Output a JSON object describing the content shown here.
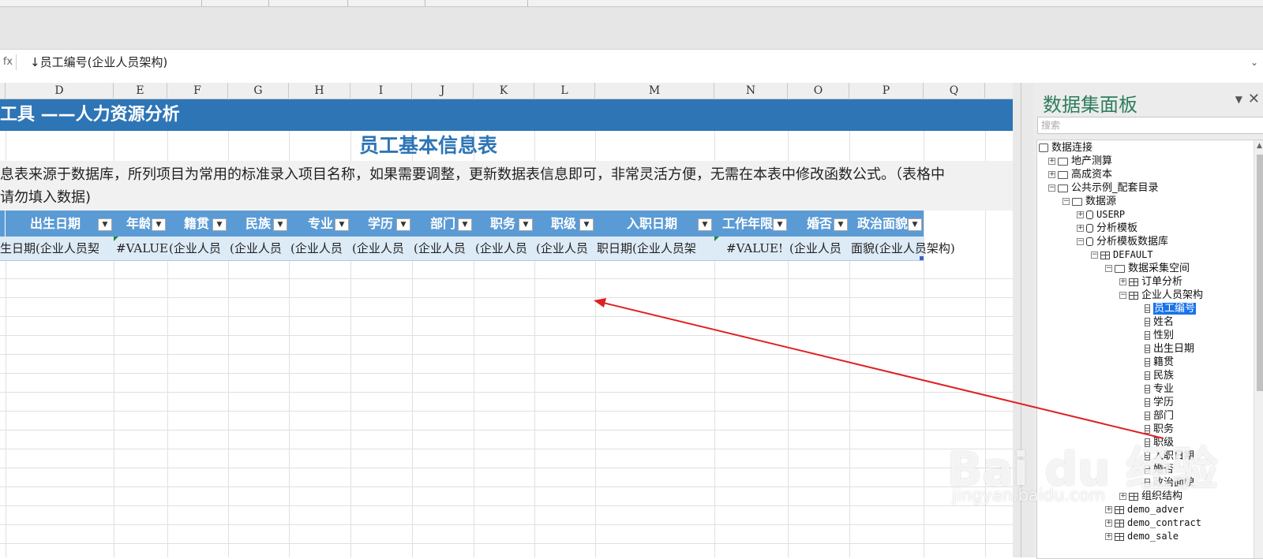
{
  "formula_bar": {
    "fx": "fx",
    "text": "↓员工编号(企业人员架构)",
    "dropdown_icon": "chevron-down-icon"
  },
  "columns": [
    "D",
    "E",
    "F",
    "G",
    "H",
    "I",
    "J",
    "K",
    "L",
    "M",
    "N",
    "O",
    "P",
    "Q"
  ],
  "sheet": {
    "band_title": "工具 ——人力资源分析",
    "title": "员工基本信息表",
    "note_line1": "息表来源于数据库，所列项目为常用的标准录入项目名称，如果需要调整，更新数据表信息即可，非常灵活方便，无需在本表中修改函数公式。（表格中",
    "note_line2": "请勿填入数据)",
    "headers": [
      "出生日期",
      "年龄",
      "籍贯",
      "民族",
      "专业",
      "学历",
      "部门",
      "职务",
      "职级",
      "入职日期",
      "工作年限",
      "婚否",
      "政治面貌"
    ],
    "filter_glyph": "▼",
    "data_row": [
      "生日期(企业人员契",
      "#VALUE!",
      "(企业人员",
      "(企业人员",
      "(企业人员",
      "(企业人员",
      "(企业人员",
      "(企业人员",
      "(企业人员",
      "职日期(企业人员架",
      "#VALUE!",
      "(企业人员",
      "面貌(企业人员架构)"
    ],
    "band_color": "#2e75b6",
    "header_color": "#5b9bd5",
    "data_row_color": "#ddebf7"
  },
  "panel": {
    "title": "数据集面板",
    "pin_glyph": "▼",
    "close_glyph": "✕",
    "search_placeholder": "搜索",
    "tree": [
      {
        "label": "数据连接",
        "icon": "connection-icon"
      },
      {
        "label": "地产测算",
        "icon": "folder-icon"
      },
      {
        "label": "高成资本",
        "icon": "folder-icon"
      },
      {
        "label": "公共示例_配套目录",
        "icon": "folder-icon"
      },
      {
        "label": "数据源",
        "icon": "folder-icon"
      },
      {
        "label": "USERP",
        "icon": "database-icon"
      },
      {
        "label": "分析模板",
        "icon": "database-icon"
      },
      {
        "label": "分析模板数据库",
        "icon": "database-icon"
      },
      {
        "label": "DEFAULT",
        "icon": "schema-icon"
      },
      {
        "label": "数据采集空间",
        "icon": "folder-icon"
      },
      {
        "label": "订单分析",
        "icon": "table-icon"
      },
      {
        "label": "企业人员架构",
        "icon": "table-icon"
      },
      {
        "label": "员工编号",
        "icon": "field-icon"
      },
      {
        "label": "姓名",
        "icon": "field-icon"
      },
      {
        "label": "性别",
        "icon": "field-icon"
      },
      {
        "label": "出生日期",
        "icon": "field-icon"
      },
      {
        "label": "籍贯",
        "icon": "field-icon"
      },
      {
        "label": "民族",
        "icon": "field-icon"
      },
      {
        "label": "专业",
        "icon": "field-icon"
      },
      {
        "label": "学历",
        "icon": "field-icon"
      },
      {
        "label": "部门",
        "icon": "field-icon"
      },
      {
        "label": "职务",
        "icon": "field-icon"
      },
      {
        "label": "职级",
        "icon": "field-icon"
      },
      {
        "label": "入职日期",
        "icon": "field-icon"
      },
      {
        "label": "婚否",
        "icon": "field-icon"
      },
      {
        "label": "政治面貌",
        "icon": "field-icon"
      },
      {
        "label": "组织结构",
        "icon": "table-icon"
      },
      {
        "label": "demo_adver",
        "icon": "table-icon"
      },
      {
        "label": "demo_contract",
        "icon": "table-icon"
      },
      {
        "label": "demo_sale",
        "icon": "table-icon"
      }
    ]
  },
  "watermark": {
    "main": "Bai du 经验",
    "sub": "jingyan.baidu.com"
  },
  "annotation": {
    "color": "#e02020"
  }
}
